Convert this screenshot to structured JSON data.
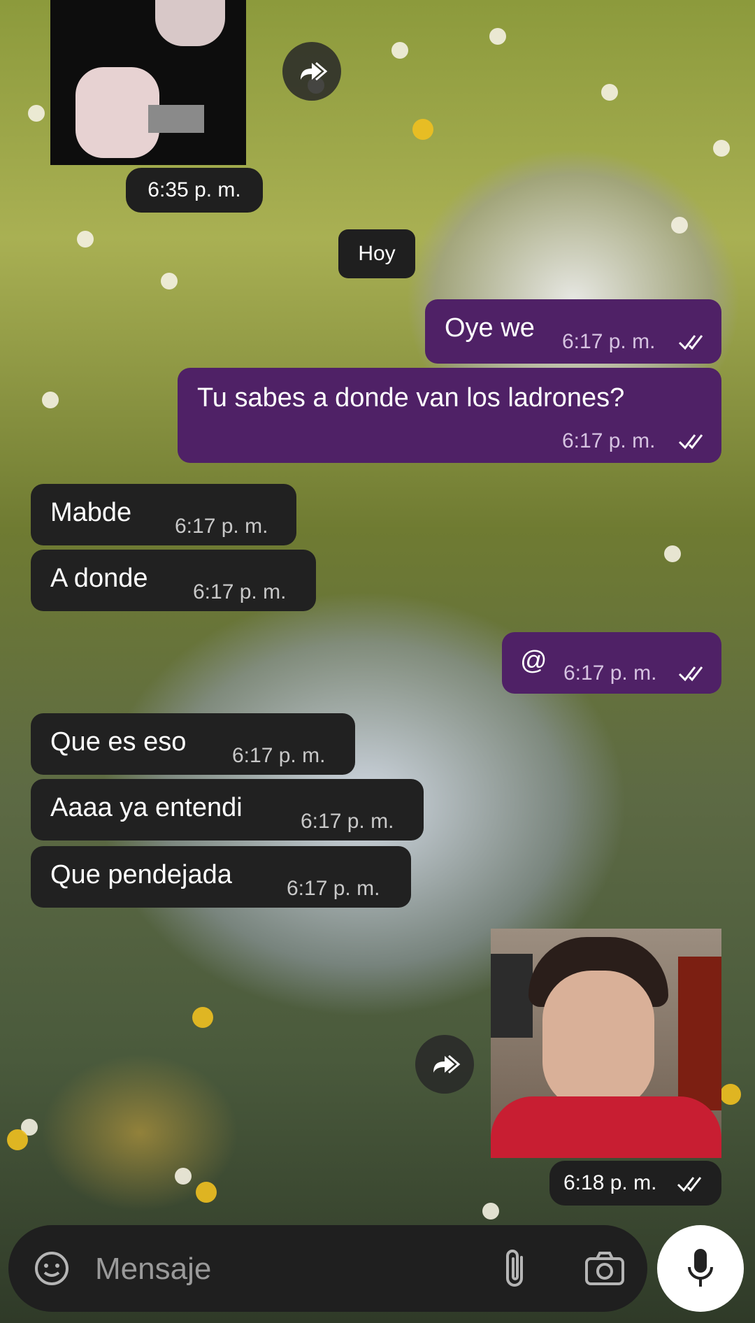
{
  "messages": {
    "photo_time": "6:35 p. m.",
    "date_separator": "Hoy",
    "outgoing": [
      {
        "text": "Oye we",
        "time": "6:17 p. m."
      },
      {
        "text": "Tu sabes a donde van los ladrones?",
        "time": "6:17 p. m."
      },
      {
        "text": "@",
        "time": "6:17 p. m."
      }
    ],
    "incoming": [
      {
        "text": "Mabde",
        "time": "6:17 p. m."
      },
      {
        "text": "A donde",
        "time": "6:17 p. m."
      },
      {
        "text": "Que es eso",
        "time": "6:17 p. m."
      },
      {
        "text": "Aaaa ya entendi",
        "time": "6:17 p. m."
      },
      {
        "text": "Que pendejada",
        "time": "6:17 p. m."
      }
    ],
    "video_time": "6:18 p. m."
  },
  "composer": {
    "placeholder": "Mensaje",
    "icons": [
      "sticker-icon",
      "attach-icon",
      "camera-icon",
      "mic-icon"
    ]
  },
  "colors": {
    "outgoing_bubble": "#4f2166",
    "incoming_bubble": "#212121",
    "composer": "#1f1f1f"
  }
}
